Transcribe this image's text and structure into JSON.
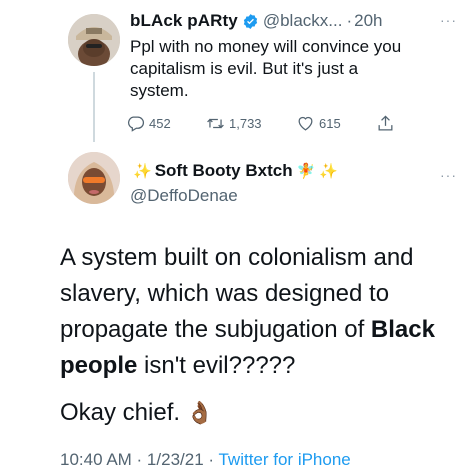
{
  "parent_tweet": {
    "display_name": "bLAck pARty",
    "handle": "@blackx...",
    "separator": "·",
    "time": "20h",
    "more": "···",
    "text": "Ppl with no money will convince you\ncapitalism is evil. But it's just a\nsystem.",
    "replies": "452",
    "retweets": "1,733",
    "likes": "615",
    "icons": [
      "reply-icon",
      "retweet-icon",
      "like-icon",
      "share-icon",
      "verified-badge-icon"
    ],
    "colors": {
      "verified": "#1d9bf0",
      "muted": "#536471"
    }
  },
  "main_tweet": {
    "name_prefix_emoji": "✨",
    "display_name": "Soft Booty Bxtch",
    "name_suffix_emoji": "🧚",
    "name_suffix_emoji_2": "✨",
    "handle": "@DeffoDenae",
    "more": "···",
    "body_part1": "A system built on colonialism and slavery, which was designed to propagate the subjugation of ",
    "body_bold": "Black people",
    "body_part2": " isn't evil?????",
    "closing": "Okay chief.",
    "closing_emoji": "👌🏾",
    "timestamp": "10:40 AM · 1/23/21 · ",
    "source": "Twitter for iPhone",
    "colors": {
      "link": "#1d9bf0",
      "text": "#0f1419"
    }
  }
}
